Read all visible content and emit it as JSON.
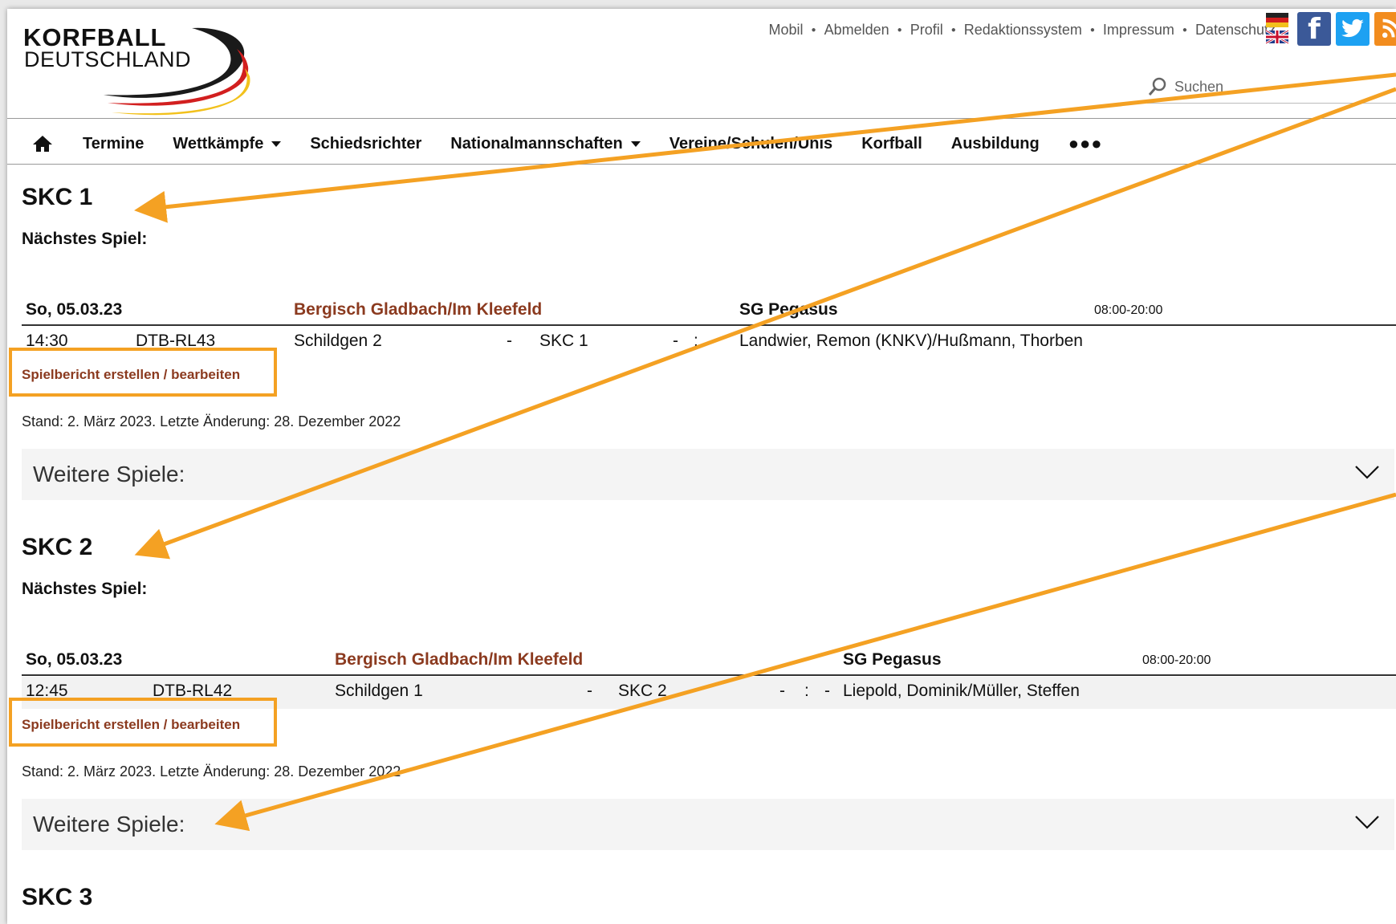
{
  "logo": {
    "line1": "KORFBALL",
    "line2": "DEUTSCHLAND"
  },
  "topnav": [
    "Mobil",
    "Abmelden",
    "Profil",
    "Redaktionssystem",
    "Impressum",
    "Datenschutz"
  ],
  "social": {
    "facebook": "f"
  },
  "search": {
    "label": "Suchen"
  },
  "mainnav": {
    "items": [
      "Termine",
      "Wettkämpfe",
      "Schiedsrichter",
      "Nationalmannschaften",
      "Vereine/Schulen/Unis",
      "Korfball",
      "Ausbildung"
    ],
    "more": "●●●"
  },
  "teams": [
    {
      "title": "SKC 1",
      "next_label": "Nächstes Spiel:",
      "head": {
        "date": "So, 05.03.23",
        "location": "Bergisch Gladbach/Im Kleefeld",
        "host": "SG Pegasus",
        "time": "08:00-20:00"
      },
      "game": {
        "time": "14:30",
        "league": "DTB-RL43",
        "home": "Schildgen 2",
        "dash": "-",
        "away": "SKC 1",
        "score_dash": "-",
        "score_colon": ":",
        "referees": "Landwier, Remon (KNKV)/Hußmann, Thorben"
      },
      "report_link": "Spielbericht erstellen / bearbeiten",
      "status": "Stand: 2. März 2023. Letzte Änderung: 28. Dezember 2022",
      "more_games": "Weitere Spiele:"
    },
    {
      "title": "SKC 2",
      "next_label": "Nächstes Spiel:",
      "head": {
        "date": "So, 05.03.23",
        "location": "Bergisch Gladbach/Im Kleefeld",
        "host": "SG Pegasus",
        "time": "08:00-20:00"
      },
      "game": {
        "time": "12:45",
        "league": "DTB-RL42",
        "home": "Schildgen 1",
        "dash": "-",
        "away": "SKC 2",
        "score_dash": "-",
        "score_colon": ":",
        "score_dash2": "-",
        "referees": "Liepold, Dominik/Müller, Steffen"
      },
      "report_link": "Spielbericht erstellen / bearbeiten",
      "status": "Stand: 2. März 2023. Letzte Änderung: 28. Dezember 2022",
      "more_games": "Weitere Spiele:"
    },
    {
      "title": "SKC 3"
    }
  ],
  "colors": {
    "annotation": "#f4a123",
    "link": "#8b3a1f"
  }
}
